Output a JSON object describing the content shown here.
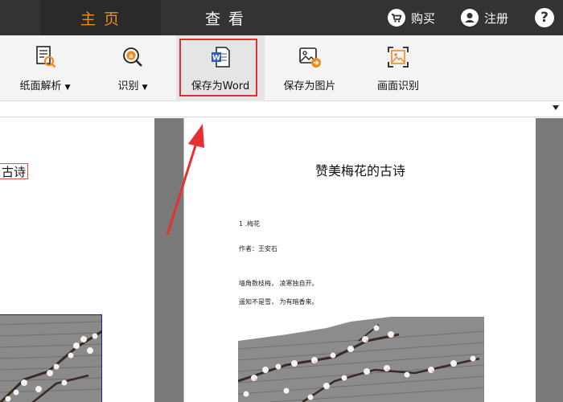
{
  "topbar": {
    "tabs": [
      {
        "label": "主 页",
        "active": true
      },
      {
        "label": "查 看",
        "active": false
      }
    ],
    "buy_label": "购买",
    "register_label": "注册",
    "help_label": "?"
  },
  "toolbar": {
    "items": [
      {
        "label": "纸面解析",
        "icon": "paper-analysis-icon",
        "has_dropdown": true
      },
      {
        "label": "识别",
        "icon": "recognize-icon",
        "has_dropdown": true
      },
      {
        "label": "保存为Word",
        "icon": "word-icon",
        "highlighted": true
      },
      {
        "label": "保存为图片",
        "icon": "save-image-icon"
      },
      {
        "label": "画面识别",
        "icon": "screen-recognize-icon"
      }
    ],
    "dropdown_glyph": "▼"
  },
  "left_page": {
    "title_fragment": "古诗"
  },
  "right_page": {
    "title": "赞美梅花的古诗",
    "lines": [
      "1 .梅花",
      "作者：王安石",
      "墙角数枝梅，  凌寒独自开。",
      "遥知不是雪，  为有暗香来。"
    ]
  },
  "colors": {
    "topbar_bg": "#333333",
    "active_tab_text": "#f28a1a",
    "highlight_border": "#e03030",
    "annotation_arrow": "#e83030",
    "word_blue": "#2b5fb8"
  }
}
